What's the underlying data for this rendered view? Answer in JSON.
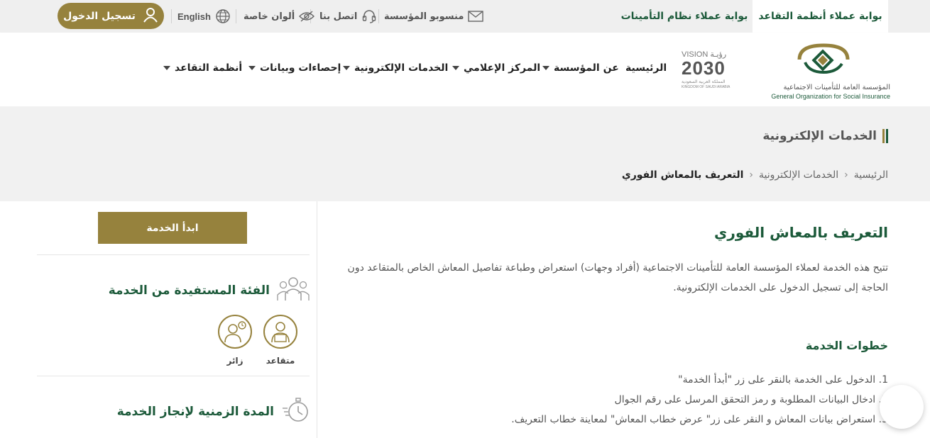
{
  "top_bar": {
    "portal_tabs": [
      {
        "label": "بوابة عملاء أنظمة التقاعد",
        "active": true
      },
      {
        "label": "بوابة عملاء نظام التأمينات",
        "active": false
      }
    ],
    "utilities": [
      {
        "label": "منسوبو المؤسسة",
        "icon": "envelope-icon"
      },
      {
        "label": "اتصل بنا",
        "icon": "headset-icon"
      },
      {
        "label": "ألوان خاصة",
        "icon": "eye-slash-icon"
      },
      {
        "label": "English",
        "icon": "globe-icon"
      }
    ],
    "login_label": "تسجيل الدخول"
  },
  "header": {
    "logo_ar": "المؤسسة العامة للتأمينات الاجتماعية",
    "logo_en": "General Organization for Social Insurance",
    "vision": {
      "title": "VISION رؤيـة",
      "year": "2030",
      "caption_ar": "المملكة العربية السعودية",
      "caption_en": "KINGDOM OF SAUDI ARABIA"
    },
    "nav": [
      {
        "label": "الرئيسية",
        "dropdown": false
      },
      {
        "label": "عن المؤسسة",
        "dropdown": true
      },
      {
        "label": "المركز الإعلامي",
        "dropdown": true
      },
      {
        "label": "الخدمات الإلكترونية",
        "dropdown": true
      },
      {
        "label": "إحصاءات وبيانات",
        "dropdown": true
      },
      {
        "label": "أنظمة التقاعد",
        "dropdown": true
      }
    ]
  },
  "page": {
    "section_title": "الخدمات الإلكترونية",
    "breadcrumb": [
      "الرئيسية",
      "الخدمات الإلكترونية",
      "التعريف بالمعاش الفوري"
    ],
    "title": "التعريف بالمعاش الفوري",
    "description": "تتيح هذه الخدمة لعملاء المؤسسة العامة للتأمينات الاجتماعية (أفراد وجهات) استعراض وطباعة تفاصيل المعاش الخاص بالمتقاعد دون الحاجة إلى تسجيل الدخول على الخدمات الإلكترونية.",
    "steps_title": "خطوات الخدمة",
    "steps": [
      "1. الدخول على الخدمة بالنقر على زر \"أبدأ الخدمة\"",
      "2. ادخال البيانات المطلوبة و رمز التحقق المرسل على رقم الجوال",
      "3. استعراض بيانات المعاش و النقر على زر\" عرض خطاب المعاش\" لمعاينة خطاب التعريف."
    ]
  },
  "side": {
    "start_label": "ابدأ الخدمة",
    "beneficiary_title": "الفئة المستفيدة من الخدمة",
    "beneficiaries": [
      {
        "label": "متقاعد",
        "icon": "retiree-icon"
      },
      {
        "label": "زائر",
        "icon": "visitor-icon"
      }
    ],
    "duration_title": "المدة الزمنية لإنجاز الخدمة"
  },
  "colors": {
    "gold": "#96823d",
    "green": "#1c5a3a",
    "band": "#f1f1f1"
  }
}
